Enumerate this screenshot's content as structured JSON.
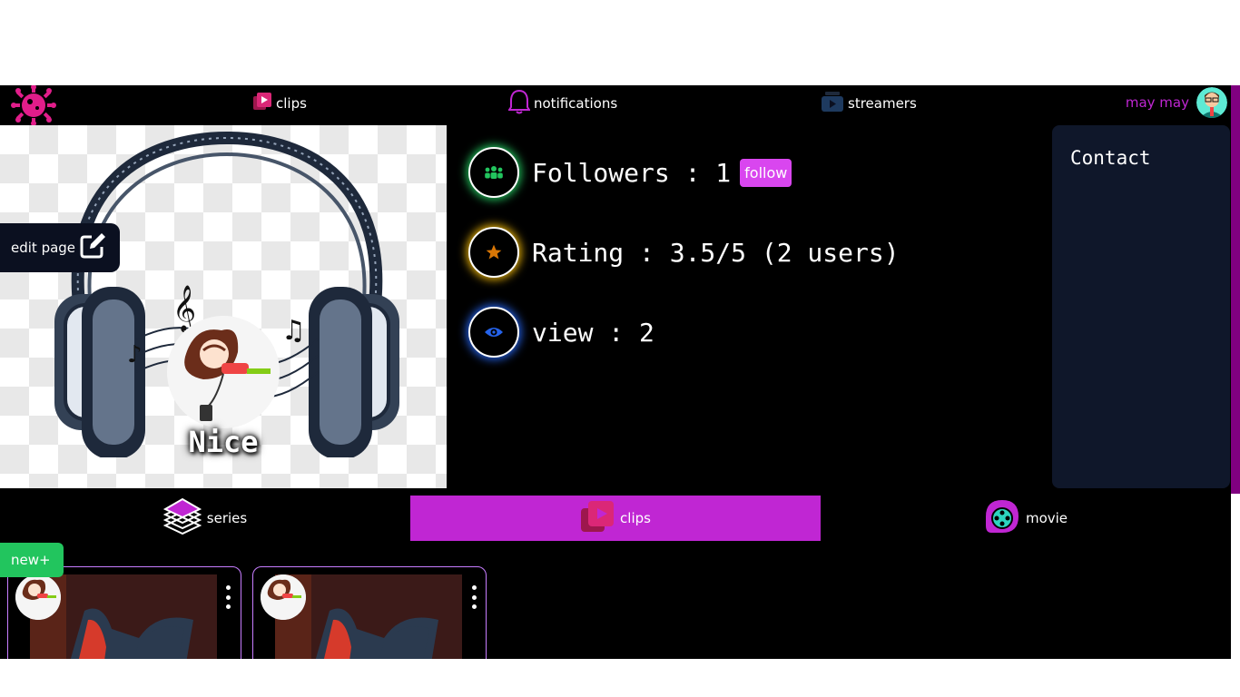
{
  "nav": {
    "logo_icon": "virus-logo-icon",
    "items": [
      {
        "label": "clips",
        "icon": "clips-icon"
      },
      {
        "label": "notifications",
        "icon": "bell-icon"
      },
      {
        "label": "streamers",
        "icon": "streamers-icon"
      }
    ],
    "user": {
      "name": "may may",
      "avatar_icon": "user-avatar"
    }
  },
  "hero": {
    "page_name": "Nice",
    "edit_label": "edit page",
    "edit_icon": "edit-icon"
  },
  "stats": {
    "followers": {
      "text": "Followers : 1",
      "icon": "users-icon",
      "glow": "#22c55e"
    },
    "follow_label": "follow",
    "rating": {
      "text": "Rating : 3.5/5 (2 users)",
      "icon": "star-icon",
      "glow": "#eab308"
    },
    "views": {
      "text": "view : 2",
      "icon": "eye-icon",
      "glow": "#2563eb"
    }
  },
  "contact": {
    "title": "Contact"
  },
  "tabs": [
    {
      "label": "series",
      "icon": "layers-icon",
      "active": false
    },
    {
      "label": "clips",
      "icon": "clips-icon",
      "active": true
    },
    {
      "label": "movie",
      "icon": "film-reel-icon",
      "active": false
    }
  ],
  "new_button": {
    "label": "new+"
  },
  "colors": {
    "accent": "#c026d3",
    "follow": "#d946ef",
    "new": "#22c55e",
    "contact_bg": "#0f172a",
    "scrollbar": "#800080"
  }
}
